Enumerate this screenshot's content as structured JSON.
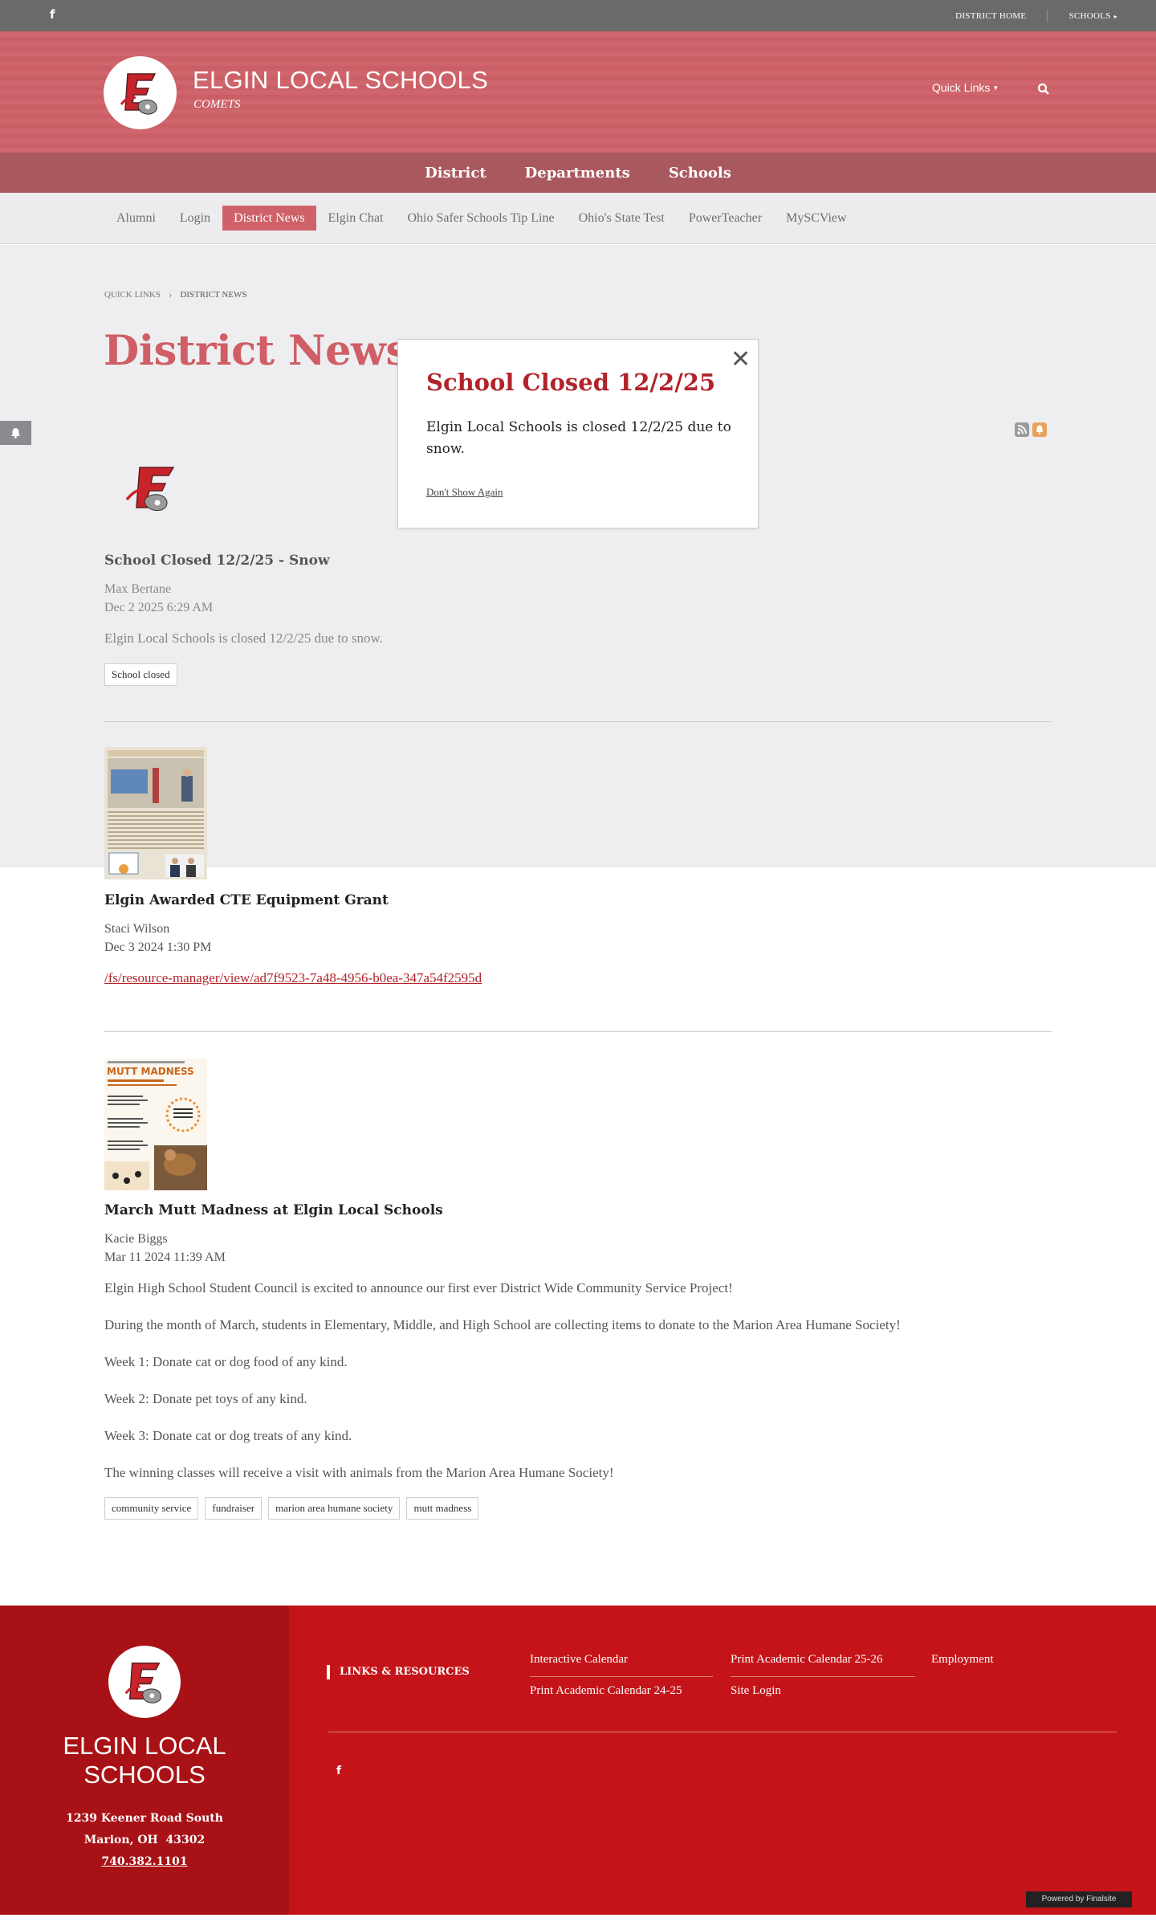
{
  "utility": {
    "facebook_icon": "f",
    "district_home": "DISTRICT HOME",
    "schools": "SCHOOLS"
  },
  "header": {
    "site_title": "ELGIN LOCAL SCHOOLS",
    "site_subtitle": "COMETS",
    "quick_links": "Quick Links"
  },
  "main_nav": [
    "District",
    "Departments",
    "Schools"
  ],
  "sub_nav": {
    "items": [
      "Alumni",
      "Login",
      "District News",
      "Elgin Chat",
      "Ohio Safer Schools Tip Line",
      "Ohio's State Test",
      "PowerTeacher",
      "MySCView"
    ],
    "active": "District News"
  },
  "breadcrumb": {
    "parent": "QUICK LINKS",
    "current": "DISTRICT NEWS"
  },
  "page_title": "District News",
  "modal": {
    "title": "School Closed 12/2/25",
    "body": "Elgin Local Schools is closed 12/2/25 due to snow.",
    "dont_show": "Don't Show Again"
  },
  "posts": [
    {
      "title": "School Closed 12/2/25 - Snow",
      "author": "Max Bertane",
      "date": "Dec 2 2025 6:29 AM",
      "text": "Elgin Local Schools is closed 12/2/25 due to snow.",
      "tags": [
        "School closed"
      ]
    },
    {
      "title": "Elgin Awarded CTE Equipment Grant",
      "author": "Staci Wilson",
      "date": "Dec 3 2024 1:30 PM",
      "link": "/fs/resource-manager/view/ad7f9523-7a48-4956-b0ea-347a54f2595d"
    },
    {
      "title": "March Mutt Madness at Elgin Local Schools",
      "author": "Kacie Biggs",
      "date": "Mar 11 2024 11:39 AM",
      "paragraphs": [
        "Elgin High School Student Council is excited to announce our first ever District Wide Community Service Project!",
        "During the month of March, students in Elementary, Middle, and High School are collecting items to donate to the Marion Area Humane Society!",
        "Week 1: Donate cat or dog food of any kind.",
        "Week 2: Donate pet toys of any kind.",
        "Week 3: Donate cat or dog treats of any kind.",
        "The winning classes will receive a visit with animals from the Marion Area Humane Society!"
      ],
      "tags": [
        "community service",
        "fundraiser",
        "marion area humane society",
        "mutt madness"
      ],
      "thumb_title": "MUTT MADNESS"
    }
  ],
  "footer": {
    "name_line1": "ELGIN LOCAL",
    "name_line2": "SCHOOLS",
    "address1": "1239 Keener Road South",
    "address2": "Marion, OH  43302",
    "phone": "740.382.1101",
    "links_heading": "LINKS & RESOURCES",
    "links": [
      "Interactive Calendar",
      "Print Academic Calendar 25-26",
      "Employment",
      "Print Academic Calendar 24-25",
      "Site Login"
    ],
    "powered_by": "Powered by Finalsite"
  },
  "colors": {
    "header_bg": "#cf6168",
    "nav_bg": "#a9585e",
    "title_red": "#cf5e66",
    "modal_red": "#b2232a",
    "footer_red": "#c41419"
  }
}
